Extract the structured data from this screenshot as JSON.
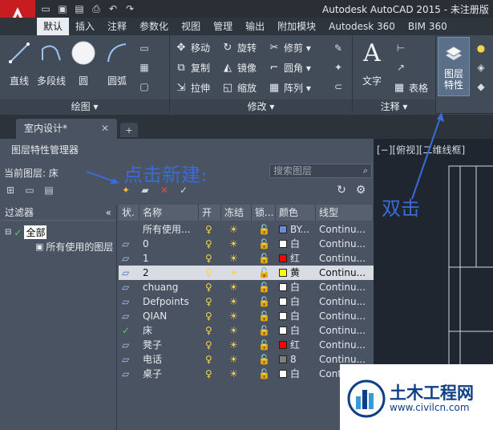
{
  "window": {
    "title": "Autodesk AutoCAD 2015 - 未注册版"
  },
  "quick_access": [
    "open-icon",
    "save-icon",
    "saveas-icon",
    "print-icon",
    "undo-icon",
    "redo-icon"
  ],
  "ribbon_tabs": [
    "默认",
    "插入",
    "注释",
    "参数化",
    "视图",
    "管理",
    "输出",
    "附加模块",
    "Autodesk 360",
    "BIM 360"
  ],
  "draw_panel": {
    "footer": "绘图 ▾",
    "tools": [
      "直线",
      "多段线",
      "圆",
      "圆弧"
    ]
  },
  "modify_panel": {
    "footer": "修改 ▾",
    "tools": [
      "移动",
      "旋转",
      "修剪 ▾",
      "复制",
      "镜像",
      "圆角 ▾",
      "拉伸",
      "缩放",
      "阵列 ▾"
    ]
  },
  "annotation_panel": {
    "footer": "注释 ▾",
    "tools": [
      "文字",
      "表格"
    ]
  },
  "layer_panel": {
    "button_line1": "图层",
    "button_line2": "特性"
  },
  "document_tab": {
    "name": "室内设计*",
    "close": "✕"
  },
  "layer_manager": {
    "title": "图层特性管理器",
    "current_layer": "当前图层: 床",
    "search_placeholder": "搜索图层",
    "filters_header": "过滤器",
    "tree": {
      "root": "全部",
      "child": "所有使用的图层"
    },
    "columns": [
      "状.",
      "名称",
      "开",
      "冻结",
      "锁...",
      "颜色",
      "线型"
    ],
    "rows": [
      {
        "name": "所有使用...",
        "color_name": "BY...",
        "color": "#6a8fd0",
        "linetype": "Continu...",
        "state": "none"
      },
      {
        "name": "0",
        "color_name": "白",
        "color": "#ffffff",
        "linetype": "Continu...",
        "state": "layer"
      },
      {
        "name": "1",
        "color_name": "红",
        "color": "#ff0000",
        "linetype": "Continu...",
        "state": "layer"
      },
      {
        "name": "2",
        "color_name": "黄",
        "color": "#ffff00",
        "linetype": "Continu...",
        "state": "layer"
      },
      {
        "name": "chuang",
        "color_name": "白",
        "color": "#ffffff",
        "linetype": "Continu...",
        "state": "layer"
      },
      {
        "name": "Defpoints",
        "color_name": "白",
        "color": "#ffffff",
        "linetype": "Continu...",
        "state": "layer"
      },
      {
        "name": "QIAN",
        "color_name": "白",
        "color": "#ffffff",
        "linetype": "Continu...",
        "state": "layer"
      },
      {
        "name": "床",
        "color_name": "白",
        "color": "#ffffff",
        "linetype": "Continu...",
        "state": "current"
      },
      {
        "name": "凳子",
        "color_name": "红",
        "color": "#ff0000",
        "linetype": "Continu...",
        "state": "layer"
      },
      {
        "name": "电话",
        "color_name": "8",
        "color": "#808080",
        "linetype": "Continu...",
        "state": "layer"
      },
      {
        "name": "桌子",
        "color_name": "白",
        "color": "#ffffff",
        "linetype": "Cont",
        "state": "layer"
      }
    ],
    "selected_row": "2"
  },
  "viewport": {
    "label": "[−][俯视][二维线框]"
  },
  "annotations": {
    "click_new": "点击新建:",
    "double_click": "双击"
  },
  "watermark": {
    "name": "土木工程网",
    "url": "www.civilcn.com"
  },
  "colors": {
    "annotation": "#3b6bd6",
    "selected_row": "#d9dde3",
    "app_red": "#c71d20"
  }
}
